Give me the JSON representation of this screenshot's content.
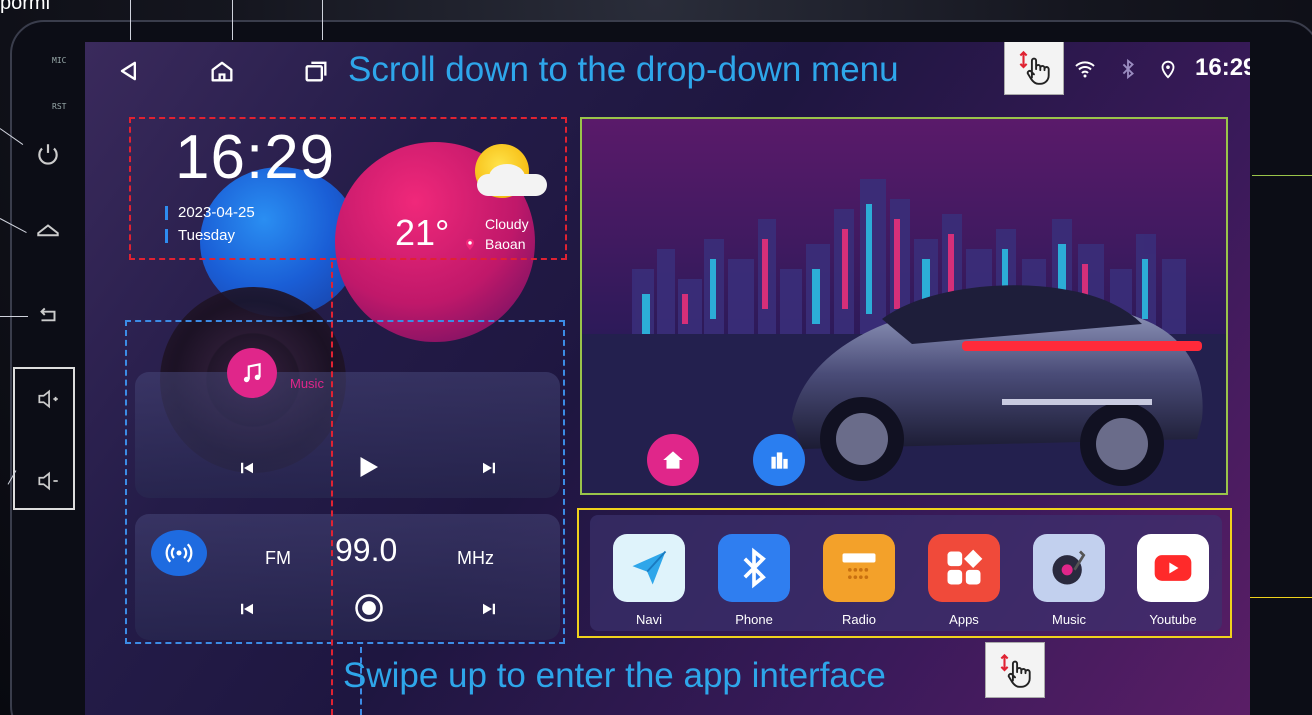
{
  "corner_text": "porml",
  "side": {
    "mic_label": "MIC",
    "rst_label": "RST"
  },
  "status": {
    "time": "16:29"
  },
  "instructions": {
    "top": "Scroll down to the drop-down menu",
    "bottom": "Swipe up to enter the app interface"
  },
  "clock_widget": {
    "time": "16:29",
    "date": "2023-04-25",
    "weekday": "Tuesday",
    "temperature": "21°",
    "condition": "Cloudy",
    "city": "Baoan"
  },
  "music_card": {
    "title": "Music"
  },
  "radio_card": {
    "band": "FM",
    "frequency": "99.0",
    "unit": "MHz"
  },
  "dock": {
    "apps": [
      {
        "label": "Navi",
        "icon": "paper-plane-icon",
        "color": "#2ea6ea"
      },
      {
        "label": "Phone",
        "icon": "bluetooth-icon",
        "color": "#2f7ef0"
      },
      {
        "label": "Radio",
        "icon": "radio-icon",
        "color": "#f3a12a"
      },
      {
        "label": "Apps",
        "icon": "apps-grid-icon",
        "color": "#f04a3a"
      },
      {
        "label": "Music",
        "icon": "vinyl-player-icon",
        "color": "#7a9ad6"
      },
      {
        "label": "Youtube",
        "icon": "youtube-icon",
        "color": "#ff2a2a"
      }
    ]
  },
  "colors": {
    "accent_blue": "#2ea6ea",
    "hero_border": "#9ac44a",
    "dock_border": "#f0d21c",
    "clock_border": "#e02232",
    "media_border": "#3c8ce6"
  }
}
